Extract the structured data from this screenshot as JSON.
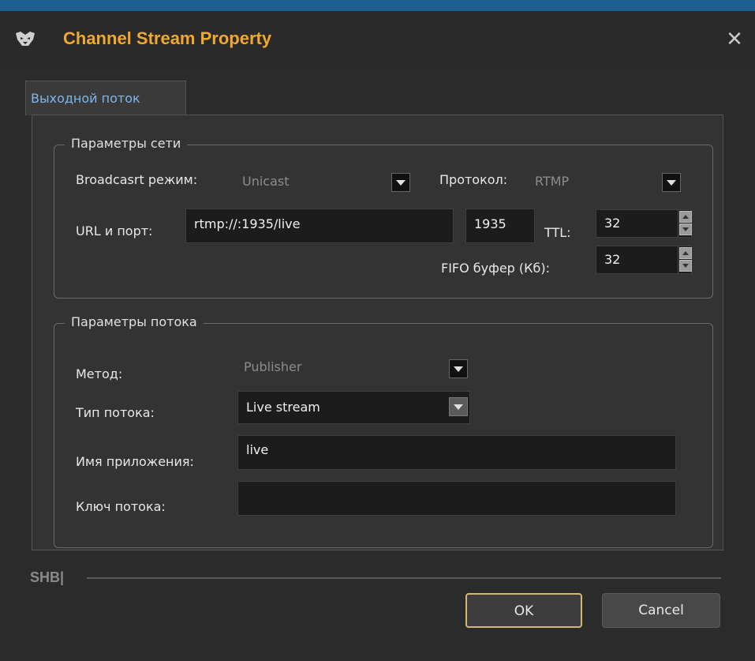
{
  "window": {
    "title": "Channel Stream Property",
    "close_glyph": "✕"
  },
  "tabs": [
    {
      "label": "Выходной поток",
      "active": true
    }
  ],
  "network": {
    "legend": "Параметры сети",
    "broadcast_label": "Broadcasrt режим:",
    "broadcast_value": "Unicast",
    "protocol_label": "Протокол:",
    "protocol_value": "RTMP",
    "url_label": "URL и порт:",
    "url_value": "rtmp://:1935/live",
    "port_value": "1935",
    "ttl_label": "TTL:",
    "ttl_value": "32",
    "fifo_label": "FIFO буфер (Кб):",
    "fifo_value": "32"
  },
  "stream": {
    "legend": "Параметры потока",
    "method_label": "Метод:",
    "method_value": "Publisher",
    "type_label": "Тип потока:",
    "type_value": "Live stream",
    "app_label": "Имя приложения:",
    "app_value": "live",
    "key_label": "Ключ потока:",
    "key_value": ""
  },
  "footer": {
    "brand": "SHB|",
    "ok_label": "OK",
    "cancel_label": "Cancel"
  },
  "colors": {
    "title_accent": "#f0a830",
    "tab_text": "#7fb6ea",
    "window_top_line": "#1e5f8f",
    "ok_border": "#d4b870"
  }
}
